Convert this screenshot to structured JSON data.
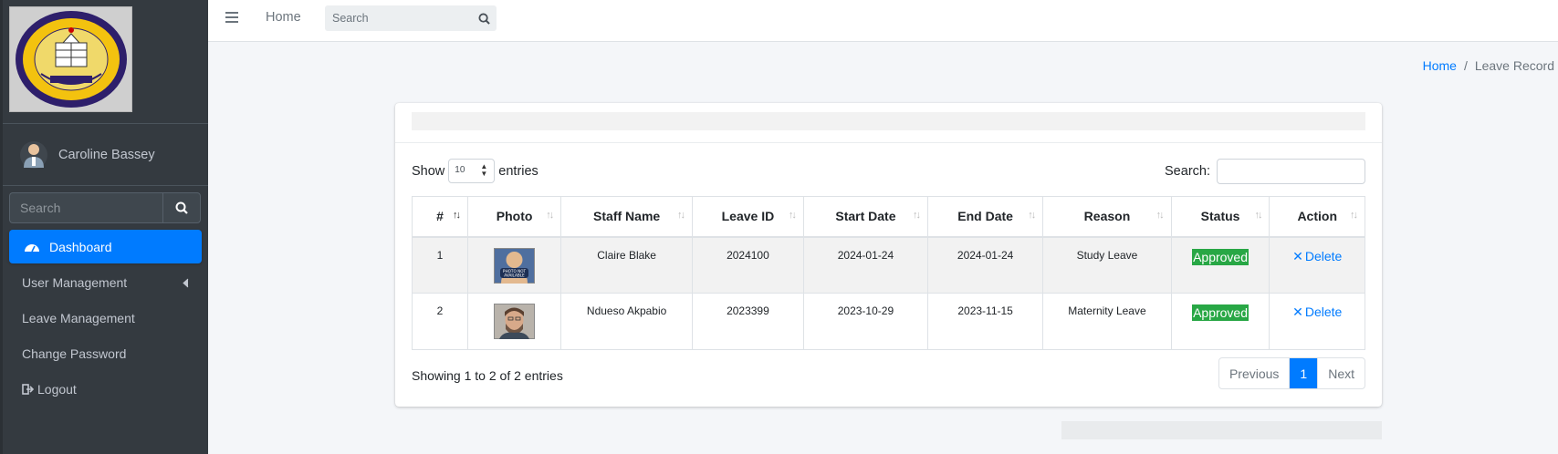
{
  "sidebar": {
    "logo_motto": "NOT EMPERE, MERCES",
    "user_name": "Caroline Bassey",
    "search_placeholder": "Search",
    "items": [
      {
        "label": "Dashboard",
        "icon": "tachometer-icon",
        "active": true
      },
      {
        "label": "User Management",
        "icon": "chevron-left-icon"
      },
      {
        "label": "Leave Management"
      },
      {
        "label": "Change Password"
      },
      {
        "label": "Logout",
        "icon": "sign-out-icon"
      }
    ]
  },
  "topbar": {
    "home": "Home",
    "search_placeholder": "Search"
  },
  "breadcrumb": {
    "home": "Home",
    "separator": "/",
    "current": "Leave Record"
  },
  "table_controls": {
    "show": "Show",
    "entries_value": "10",
    "entries": "entries",
    "search_label": "Search:"
  },
  "table": {
    "headers": [
      "#",
      "Photo",
      "Staff Name",
      "Leave ID",
      "Start Date",
      "End Date",
      "Reason",
      "Status",
      "Action"
    ],
    "rows": [
      {
        "num": "1",
        "photo": "photo-not-available",
        "name": "Claire Blake",
        "leave_id": "2024100",
        "start": "2024-01-24",
        "end": "2024-01-24",
        "reason": "Study Leave",
        "status": "Approved",
        "action": "Delete"
      },
      {
        "num": "2",
        "photo": "staff-photo",
        "name": "Ndueso Akpabio",
        "leave_id": "2023399",
        "start": "2023-10-29",
        "end": "2023-11-15",
        "reason": "Maternity Leave",
        "status": "Approved",
        "action": "Delete"
      }
    ]
  },
  "footer": {
    "info_prefix": "Showing ",
    "info_from": "1",
    "info_to_word": " to ",
    "info_to": "2",
    "info_of_word": " of ",
    "info_total": "2",
    "info_suffix": " entries",
    "previous": "Previous",
    "page": "1",
    "next": "Next"
  },
  "colors": {
    "sidebar_bg": "#343a40",
    "accent": "#007bff",
    "success": "#28a745"
  }
}
